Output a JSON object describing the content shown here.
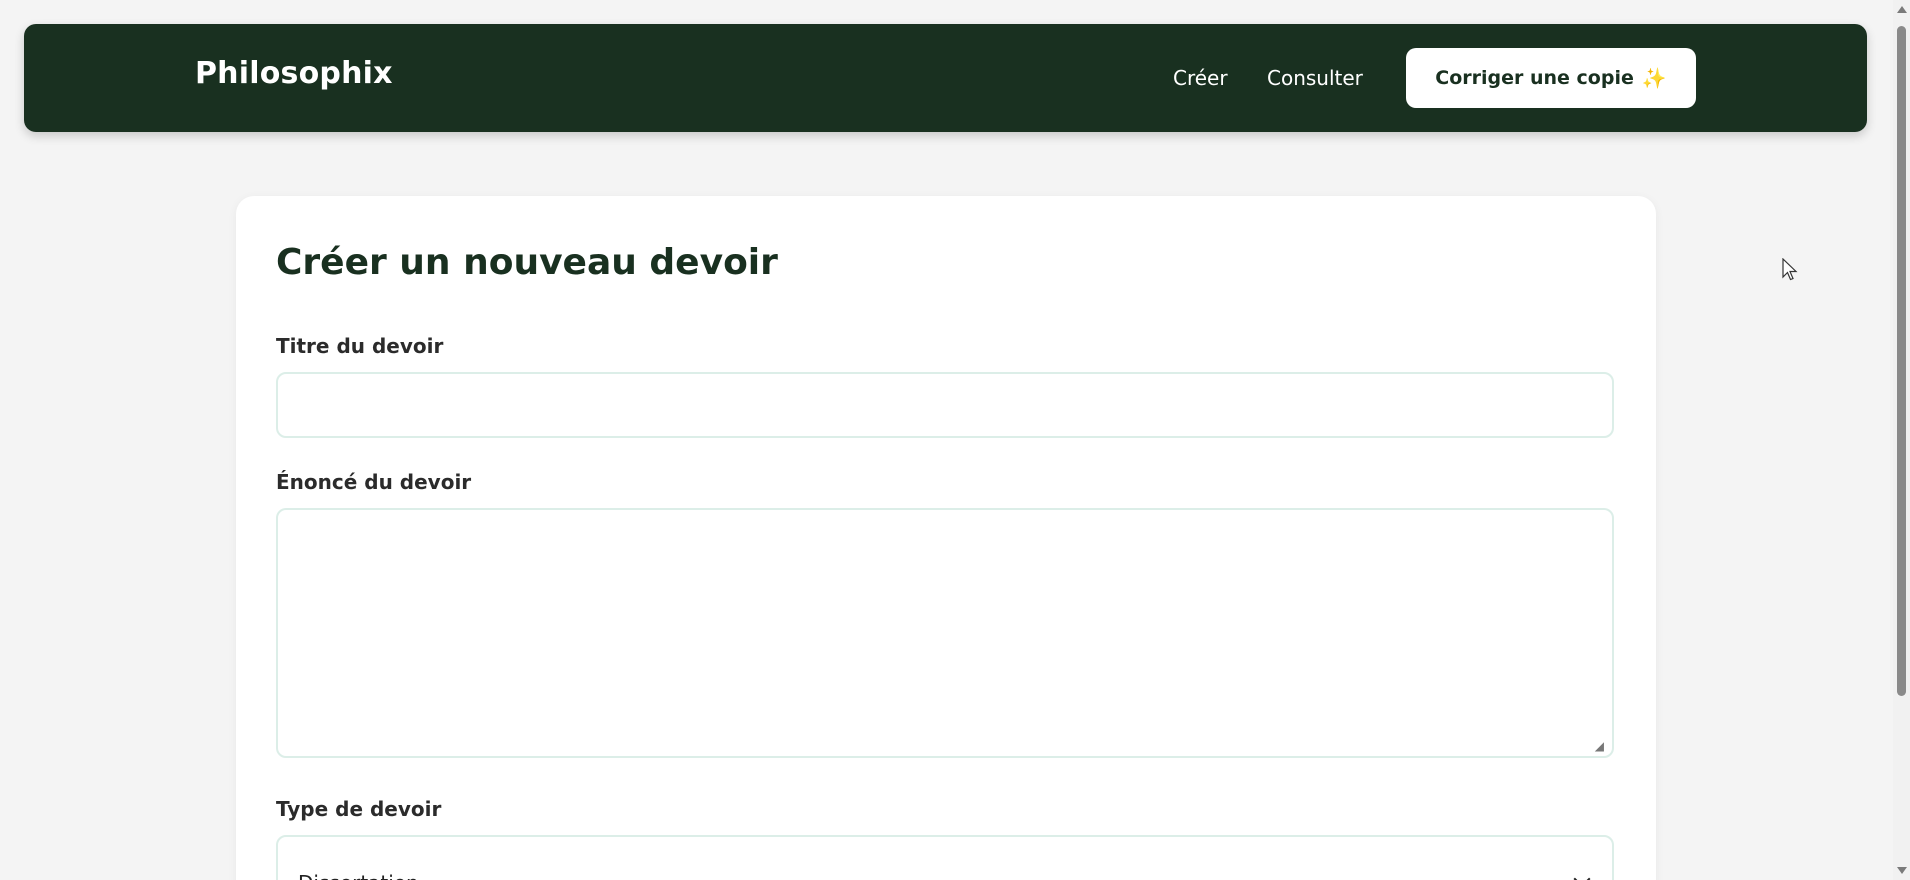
{
  "app": {
    "brand": "Philosophix"
  },
  "nav": {
    "links": [
      {
        "label": "Créer"
      },
      {
        "label": "Consulter"
      }
    ],
    "cta_label": "Corriger une copie",
    "cta_emoji": "✨"
  },
  "form": {
    "title": "Créer un nouveau devoir",
    "fields": {
      "titre": {
        "label": "Titre du devoir",
        "value": "",
        "placeholder": ""
      },
      "enonce": {
        "label": "Énoncé du devoir",
        "value": "",
        "placeholder": ""
      },
      "type": {
        "label": "Type de devoir",
        "selected": "Dissertation"
      }
    }
  },
  "colors": {
    "nav_bg": "#193020",
    "accent_text": "#193020",
    "page_bg": "#f4f4f4",
    "card_bg": "#ffffff",
    "input_border": "#dceee8"
  },
  "icons": {
    "select": "chevron-down-icon",
    "cursor": "mouse-pointer-icon",
    "cta": "sparkles-icon"
  }
}
